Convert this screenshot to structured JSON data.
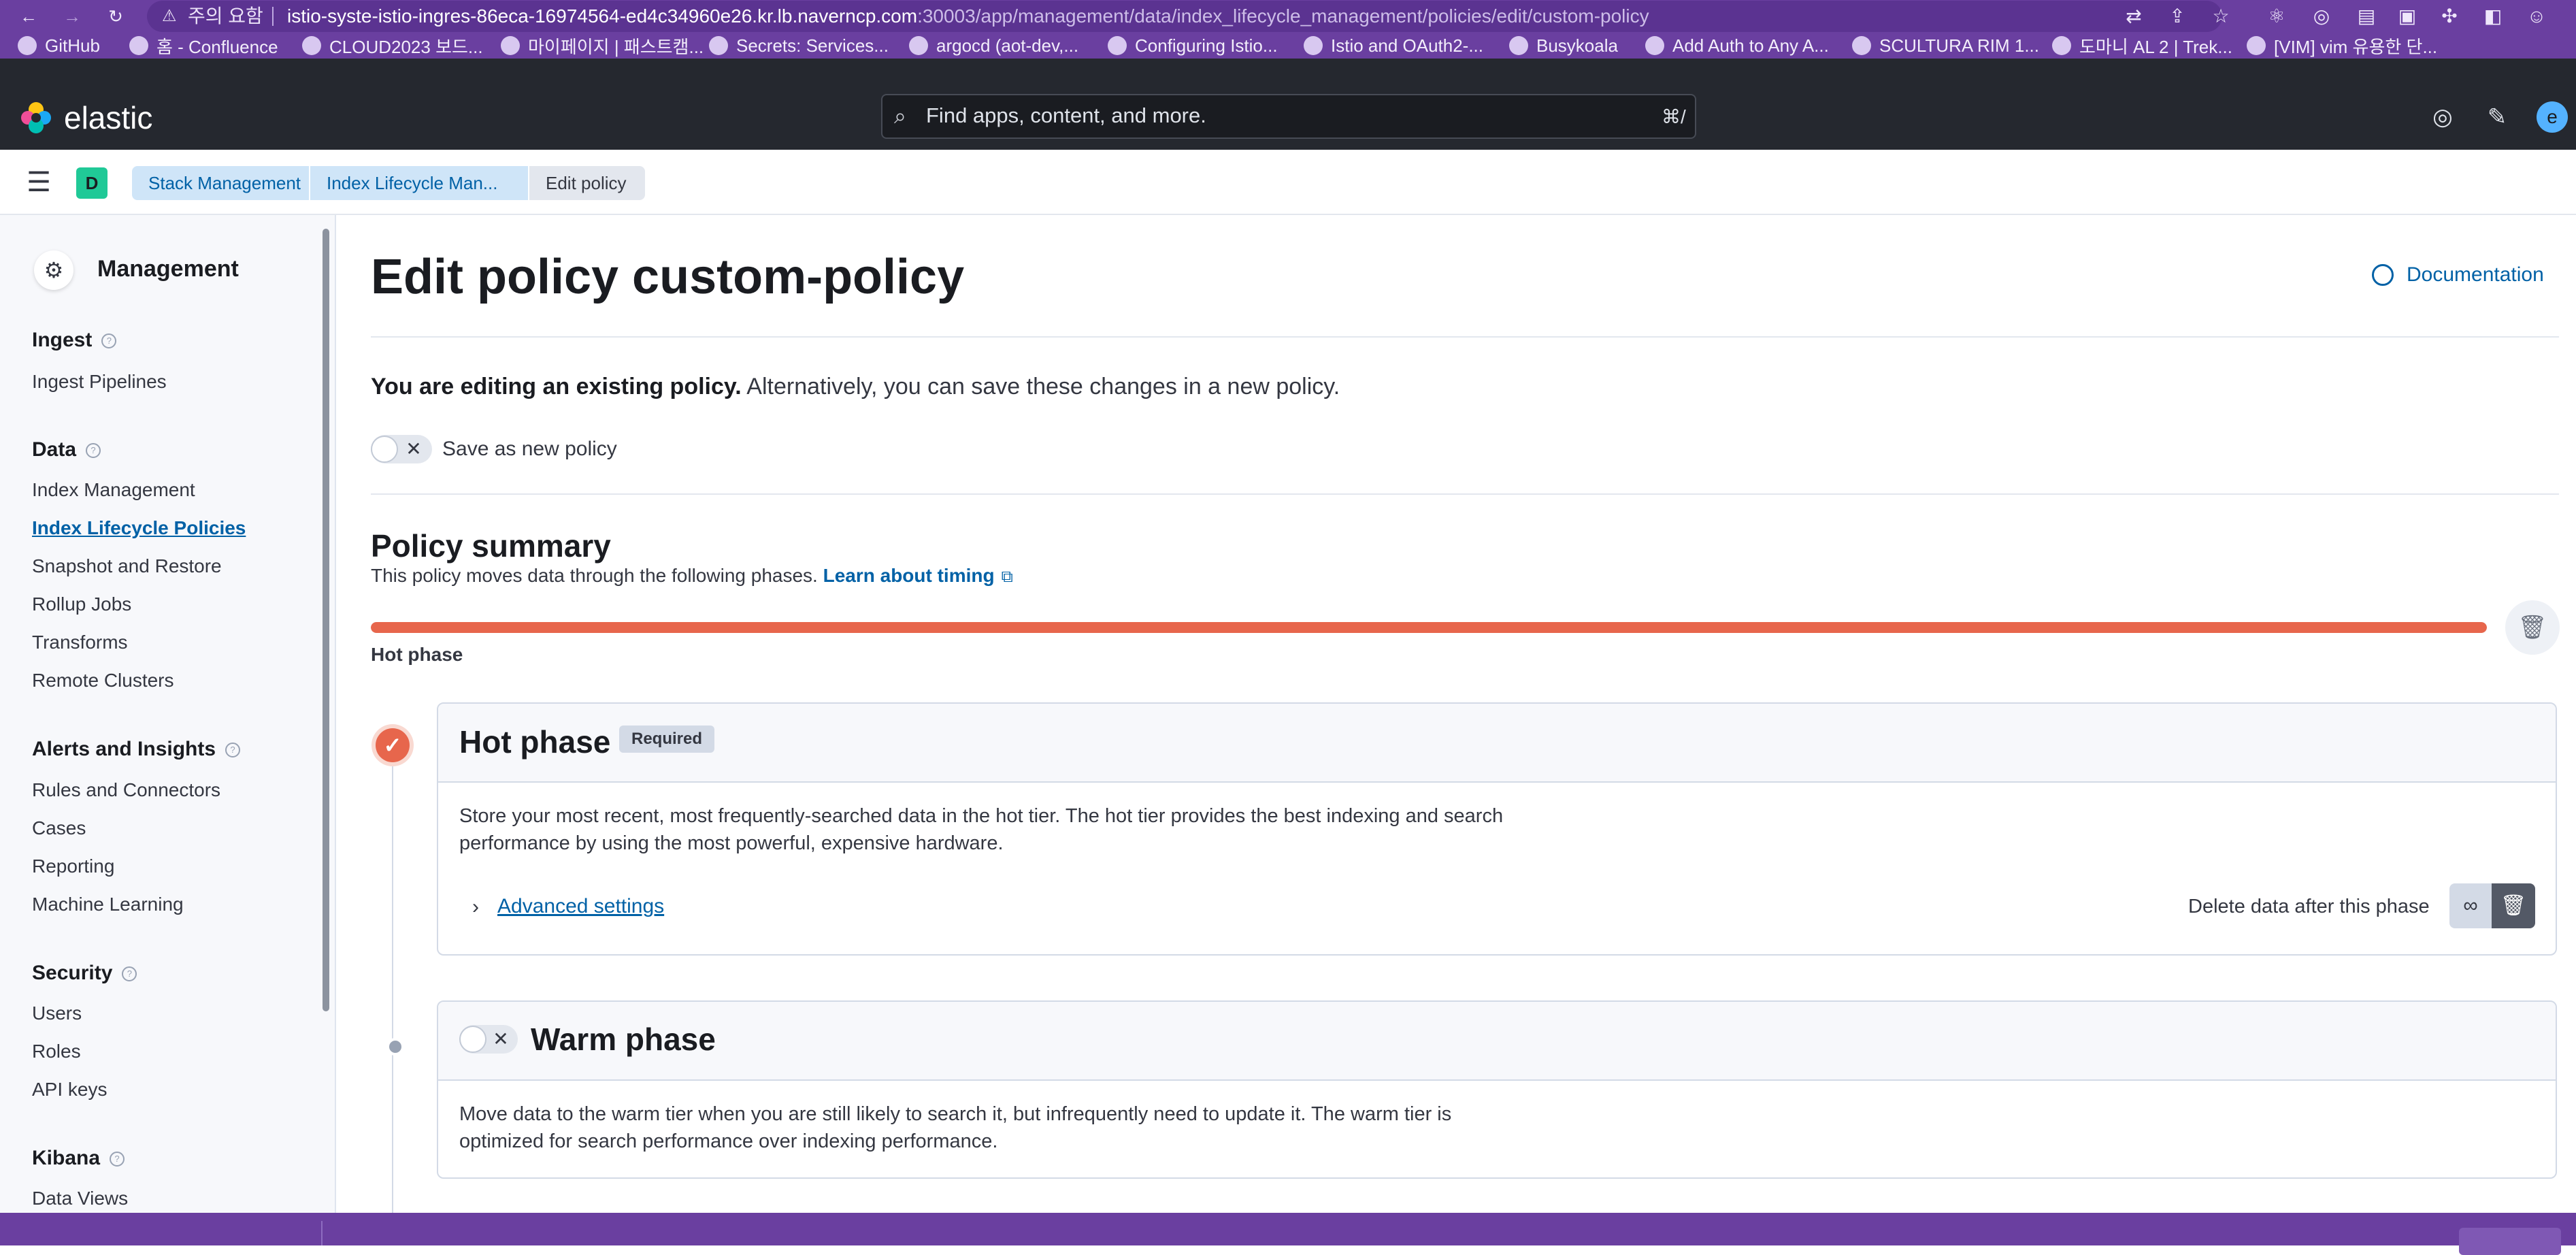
{
  "browser": {
    "security_warning": "주의 요함",
    "url_host": "istio-syste-istio-ingres-86eca-16974564-ed4c34960e26.kr.lb.naverncp.com",
    "url_path": ":30003/app/management/data/index_lifecycle_management/policies/edit/custom-policy",
    "bookmarks": [
      {
        "label": "GitHub",
        "icon": "github-icon"
      },
      {
        "label": "홈 - Confluence",
        "icon": "confluence-icon"
      },
      {
        "label": "CLOUD2023 보드...",
        "icon": "jira-icon"
      },
      {
        "label": "마이페이지 | 패스트캠...",
        "icon": "fastcampus-icon"
      },
      {
        "label": "Secrets: Services...",
        "icon": "confluence-icon"
      },
      {
        "label": "argocd (aot-dev,...",
        "icon": "argocd-icon"
      },
      {
        "label": "Configuring Istio...",
        "icon": "istio-icon"
      },
      {
        "label": "Istio and OAuth2-...",
        "icon": "istio-icon"
      },
      {
        "label": "Busykoala",
        "icon": "busykoala-icon"
      },
      {
        "label": "Add Auth to Any A...",
        "icon": "auth-icon"
      },
      {
        "label": "SCULTURA RIM 1...",
        "icon": "scultura-icon"
      },
      {
        "label": "도마니 AL 2 | Trek...",
        "icon": "trek-icon"
      },
      {
        "label": "[VIM] vim 유용한 단...",
        "icon": "vim-icon"
      }
    ]
  },
  "header": {
    "brand": "elastic",
    "search_placeholder": "Find apps, content, and more.",
    "search_shortcut": "⌘/",
    "avatar_initial": "e"
  },
  "breadcrumbs": {
    "space_initial": "D",
    "items": [
      "Stack Management",
      "Index Lifecycle Man...",
      "Edit policy"
    ]
  },
  "sidebar": {
    "title": "Management",
    "groups": [
      {
        "label": "Ingest",
        "items": [
          "Ingest Pipelines"
        ]
      },
      {
        "label": "Data",
        "items": [
          "Index Management",
          "Index Lifecycle Policies",
          "Snapshot and Restore",
          "Rollup Jobs",
          "Transforms",
          "Remote Clusters"
        ]
      },
      {
        "label": "Alerts and Insights",
        "items": [
          "Rules and Connectors",
          "Cases",
          "Reporting",
          "Machine Learning"
        ]
      },
      {
        "label": "Security",
        "items": [
          "Users",
          "Roles",
          "API keys"
        ]
      },
      {
        "label": "Kibana",
        "items": [
          "Data Views"
        ]
      }
    ],
    "active_item": "Index Lifecycle Policies"
  },
  "main": {
    "title": "Edit policy custom-policy",
    "documentation_label": "Documentation",
    "edit_note_bold": "You are editing an existing policy.",
    "edit_note_rest": " Alternatively, you can save these changes in a new policy.",
    "save_as_new_label": "Save as new policy",
    "save_as_new_enabled": false,
    "summary_title": "Policy summary",
    "summary_sub": "This policy moves data through the following phases.",
    "learn_timing": "Learn about timing",
    "timeline_fill_fraction": 1.0,
    "timeline_label": "Hot phase",
    "hot": {
      "title": "Hot phase",
      "badge": "Required",
      "description": "Store your most recent, most frequently-searched data in the hot tier. The hot tier provides the best indexing and search performance by using the most powerful, expensive hardware.",
      "advanced_settings": "Advanced settings",
      "delete_label": "Delete data after this phase"
    },
    "warm": {
      "title": "Warm phase",
      "enabled": false,
      "description": "Move data to the warm tier when you are still likely to search it, but infrequently need to update it. The warm tier is optimized for search performance over indexing performance."
    }
  },
  "colors": {
    "hot_phase": "#e7664c",
    "link": "#0061a6",
    "header_bg": "#25282f",
    "browser_bg": "#6a3fa0"
  }
}
